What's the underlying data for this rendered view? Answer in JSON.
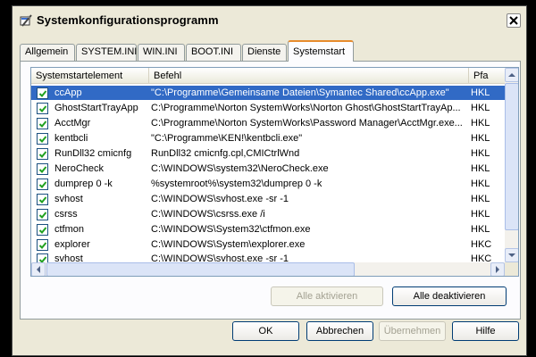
{
  "window": {
    "title": "Systemkonfigurationsprogramm",
    "close_icon": "close-x-icon"
  },
  "tabs": [
    {
      "label": "Allgemein"
    },
    {
      "label": "SYSTEM.INI"
    },
    {
      "label": "WIN.INI"
    },
    {
      "label": "BOOT.INI"
    },
    {
      "label": "Dienste"
    },
    {
      "label": "Systemstart",
      "active": true
    }
  ],
  "list": {
    "columns": [
      "Systemstartelement",
      "Befehl",
      "Pfa"
    ],
    "rows": [
      {
        "name": "ccApp",
        "command": "\"C:\\Programme\\Gemeinsame Dateien\\Symantec Shared\\ccApp.exe\"",
        "path": "HKL",
        "checked": true,
        "selected": true
      },
      {
        "name": "GhostStartTrayApp",
        "command": "C:\\Programme\\Norton SystemWorks\\Norton Ghost\\GhostStartTrayAp...",
        "path": "HKL",
        "checked": true
      },
      {
        "name": "AcctMgr",
        "command": "C:\\Programme\\Norton SystemWorks\\Password Manager\\AcctMgr.exe...",
        "path": "HKL",
        "checked": true
      },
      {
        "name": "kentbcli",
        "command": "\"C:\\Programme\\KEN!\\kentbcli.exe\"",
        "path": "HKL",
        "checked": true
      },
      {
        "name": "RunDll32 cmicnfg",
        "command": "RunDll32 cmicnfg.cpl,CMICtrlWnd",
        "path": "HKL",
        "checked": true
      },
      {
        "name": "NeroCheck",
        "command": "C:\\WINDOWS\\system32\\NeroCheck.exe",
        "path": "HKL",
        "checked": true
      },
      {
        "name": "dumprep 0 -k",
        "command": "%systemroot%\\system32\\dumprep 0 -k",
        "path": "HKL",
        "checked": true
      },
      {
        "name": "svhost",
        "command": "C:\\WINDOWS\\svhost.exe -sr -1",
        "path": "HKL",
        "checked": true
      },
      {
        "name": "csrss",
        "command": "C:\\WINDOWS\\csrss.exe /i",
        "path": "HKL",
        "checked": true
      },
      {
        "name": "ctfmon",
        "command": "C:\\WINDOWS\\System32\\ctfmon.exe",
        "path": "HKL",
        "checked": true
      },
      {
        "name": "explorer",
        "command": "C:\\WINDOWS\\System\\explorer.exe",
        "path": "HKC",
        "checked": true
      },
      {
        "name": "svhost",
        "command": "C:\\WINDOWS\\svhost.exe -sr -1",
        "path": "HKC",
        "checked": true
      }
    ]
  },
  "buttons": {
    "enable_all": "Alle aktivieren",
    "disable_all": "Alle deaktivieren",
    "ok": "OK",
    "cancel": "Abbrechen",
    "apply": "Übernehmen",
    "help": "Hilfe"
  },
  "colors": {
    "selection": "#316ac5",
    "active_tab_accent": "#e68b2c"
  }
}
